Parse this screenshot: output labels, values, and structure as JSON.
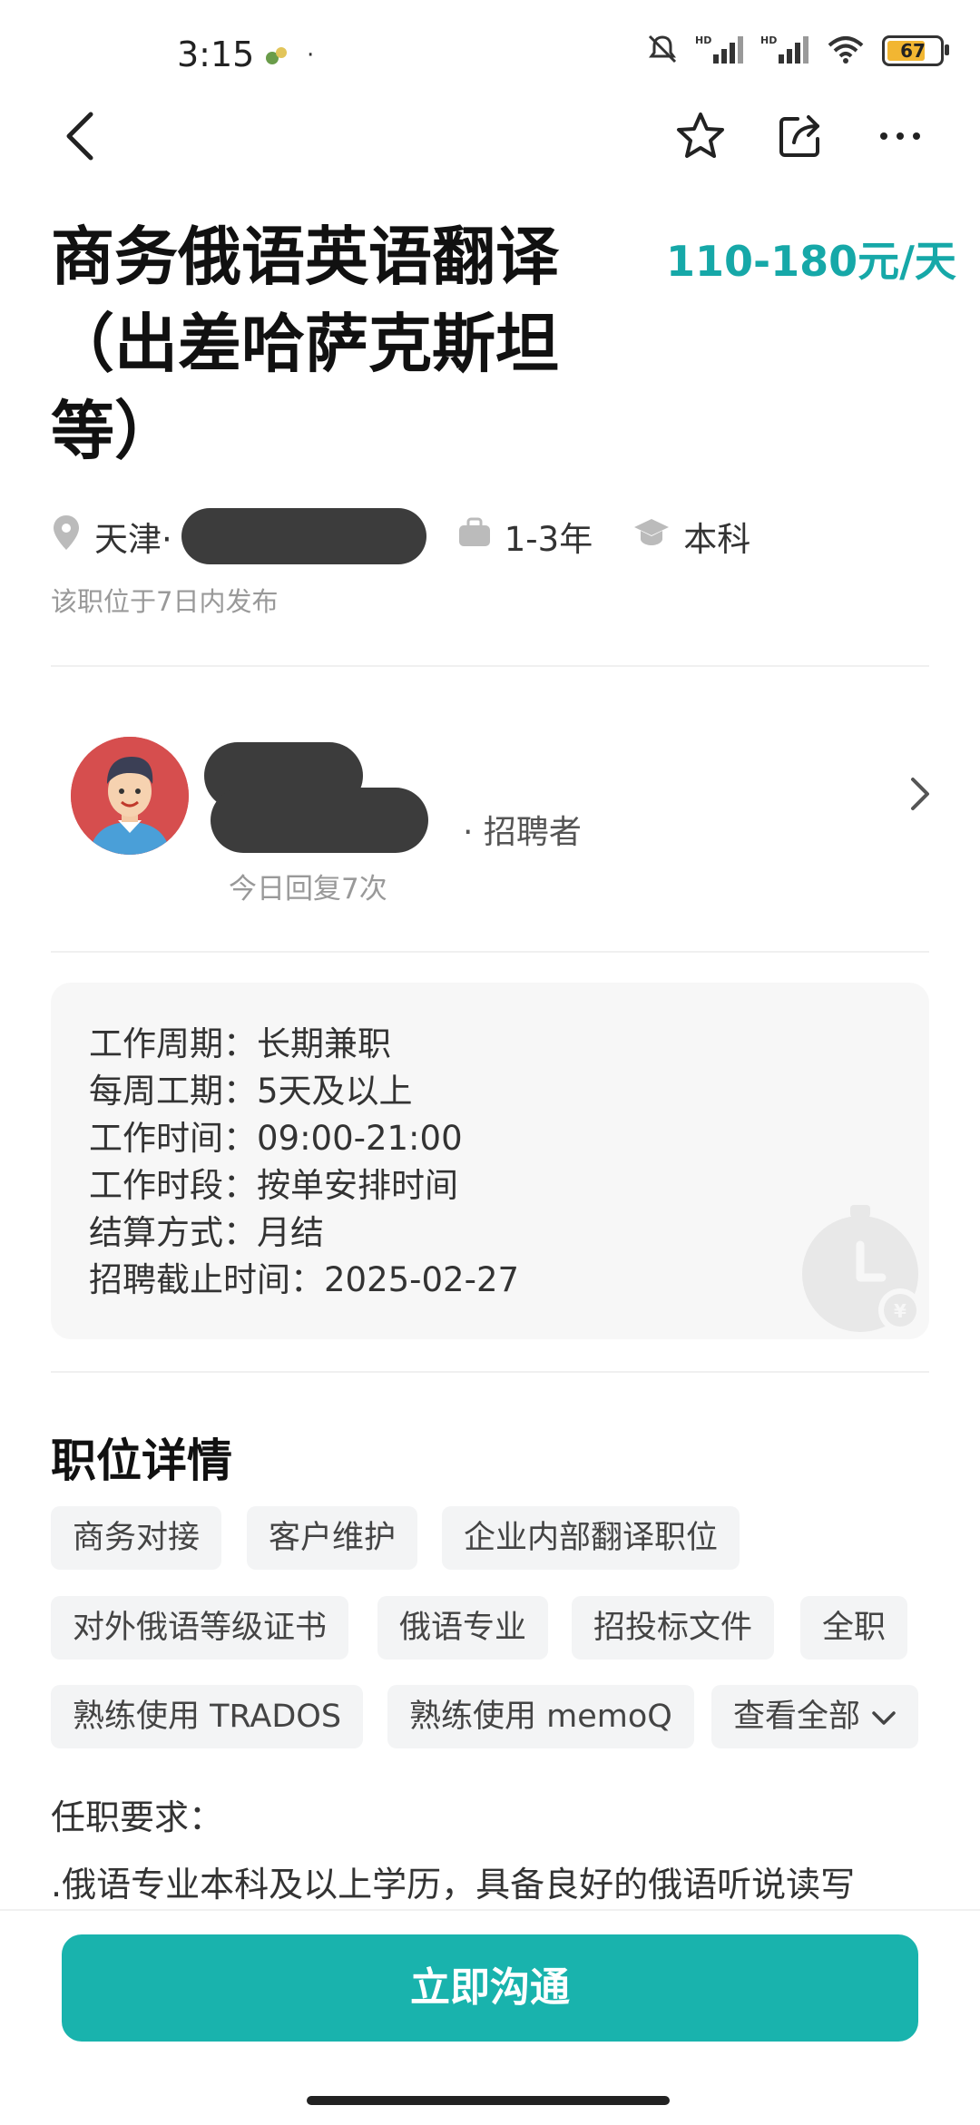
{
  "status_bar": {
    "time": "3:15",
    "dot": "·",
    "battery": "67",
    "icons": [
      "bell-muted-icon",
      "hd-signal-icon",
      "hd-signal-icon",
      "wifi-icon",
      "battery-icon"
    ]
  },
  "nav": {
    "icons": [
      "back-icon",
      "star-icon",
      "share-icon",
      "more-icon"
    ]
  },
  "job": {
    "title": "商务俄语英语翻译（出差哈萨克斯坦等）",
    "salary": "110-180元/天",
    "city": "天津·",
    "experience": "1-3年",
    "education": "本科",
    "posted": "该职位于7日内发布"
  },
  "recruiter": {
    "role": "· 招聘者",
    "reply": "今日回复7次"
  },
  "info": {
    "lines": [
      "工作周期：长期兼职",
      "每周工期：5天及以上",
      "工作时间：09:00-21:00",
      "工作时段：按单安排时间",
      "结算方式：月结",
      "招聘截止时间：2025-02-27"
    ]
  },
  "details": {
    "title": "职位详情",
    "tags": [
      "商务对接",
      "客户维护",
      "企业内部翻译职位",
      "对外俄语等级证书",
      "俄语专业",
      "招投标文件",
      "全职",
      "熟练使用 TRADOS",
      "熟练使用 memoQ"
    ],
    "view_all": "查看全部",
    "requirements_label": "任职要求：",
    "requirements_text": ".俄语专业本科及以上学历，具备良好的俄语听说读写"
  },
  "cta": {
    "label": "立即沟通"
  },
  "colors": {
    "accent": "#16a8a8",
    "button": "#19b3ad"
  }
}
